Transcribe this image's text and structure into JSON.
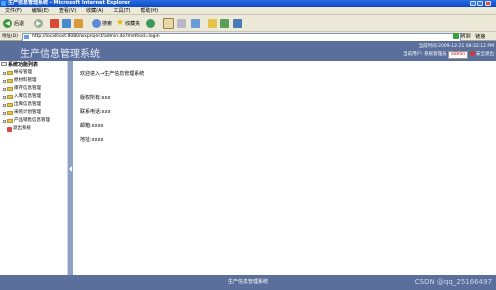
{
  "window": {
    "title": "生产信息管理系统 - Microsoft Internet Explorer"
  },
  "menu": [
    "文件(F)",
    "编辑(E)",
    "查看(V)",
    "收藏(A)",
    "工具(T)",
    "帮助(H)"
  ],
  "toolbar": {
    "back": "后退",
    "search": "搜索",
    "favorites": "收藏夹"
  },
  "address": {
    "label": "地址(D)",
    "url": "http://localhost:8080/wxproject/admin.do?method=login",
    "go": "转到",
    "links": "链接"
  },
  "header": {
    "title": "生产信息管理系统",
    "time_label": "当前时间:",
    "time_value": "2009-12-21 08:32:12 PM",
    "user_label": "当前用户: 系统管理员",
    "user_name": "admin",
    "logout": "安全退出"
  },
  "sidebar": {
    "title": "系统功能列表",
    "items": [
      "帐号管理",
      "原材料管理",
      "库存信息管理",
      "入库信息管理",
      "出库信息管理",
      "采购计划管理",
      "产品销售信息管理"
    ],
    "exit": "退出系统"
  },
  "main": {
    "welcome": "欢迎进入→生产信息管理系统",
    "copyright": "版权所有:xxx",
    "phone": "联系电话:xxx",
    "email": "邮箱:xxxx",
    "address": "地址:xxxx"
  },
  "footer": {
    "text": "生产信息管理系统",
    "watermark": "CSDN @qq_25166497"
  }
}
